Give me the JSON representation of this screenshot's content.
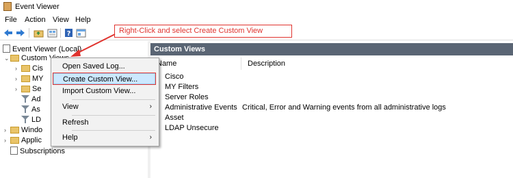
{
  "window": {
    "title": "Event Viewer"
  },
  "menu": [
    "File",
    "Action",
    "View",
    "Help"
  ],
  "toolbar": {
    "icons": [
      "back-arrow-icon",
      "forward-arrow-icon",
      "folder-up-icon",
      "properties-icon",
      "help-icon",
      "show-hide-icon"
    ]
  },
  "tree": {
    "root": "Event Viewer (Local)",
    "custom_views": "Custom Views",
    "partial_children": [
      "Cis",
      "MY",
      "Se",
      "Ad",
      "As",
      "LD"
    ],
    "windows_logs": "Windo",
    "applications_logs": "Applic",
    "subscriptions": "Subscriptions"
  },
  "context_menu": {
    "items": [
      "Open Saved Log...",
      "Create Custom View...",
      "Import Custom View...",
      "View",
      "Refresh",
      "Help"
    ],
    "selected": "Create Custom View..."
  },
  "callout": {
    "text": "Right-Click and select Create Custom View"
  },
  "right_pane": {
    "header": "Custom Views",
    "columns": [
      "Name",
      "Description"
    ],
    "rows": [
      {
        "name": "Cisco",
        "description": ""
      },
      {
        "name": "MY Filters",
        "description": ""
      },
      {
        "name": "Server Roles",
        "description": ""
      },
      {
        "name": "Administrative Events",
        "description": "Critical, Error and Warning events from all administrative logs"
      },
      {
        "name": "Asset",
        "description": ""
      },
      {
        "name": "LDAP Unsecure",
        "description": ""
      }
    ]
  },
  "colors": {
    "accent": "#e0332e",
    "header_bg": "#5a6574",
    "selection_bg": "#cce8ff",
    "folder": "#e9c46a"
  }
}
